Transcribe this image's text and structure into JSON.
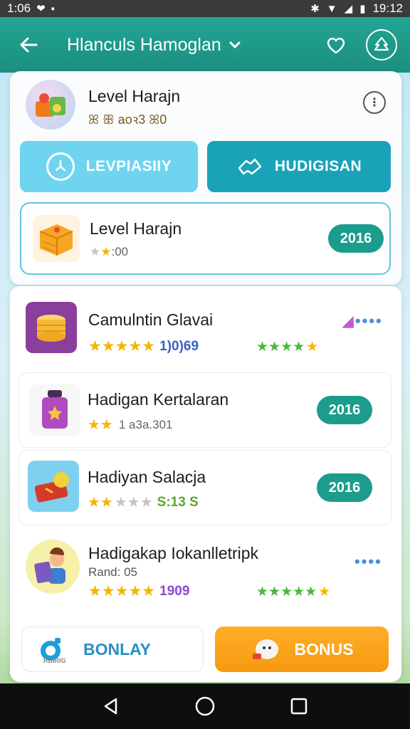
{
  "status_bar": {
    "time": "1:06",
    "right_time": "19:12"
  },
  "app_bar": {
    "title": "Hlanculs Hamoglan"
  },
  "header": {
    "title": "Level Harajn",
    "subtitle": "ꕤ ꕥ aoꝛ3 ꕤ0"
  },
  "tabs": [
    {
      "label": "LEVPIASIIY",
      "icon": "clock-icon"
    },
    {
      "label": "HUDIGISAN",
      "icon": "handshake-icon"
    }
  ],
  "featured": {
    "title": "Level Harajn",
    "rating_text": ":00",
    "badge": "2016"
  },
  "list": [
    {
      "title": "Camulntin Glavai",
      "score": "1)0)69",
      "badge": ""
    },
    {
      "title": "Hadigan Kertalaran",
      "sub": "1 a3a.301",
      "badge": "2016"
    },
    {
      "title": "Hadiyan Salacja",
      "score": "S:13 S",
      "badge": "2016"
    },
    {
      "title": "Hadigakap Iokanlletripk",
      "sub": "Rand: 05",
      "score": "1909"
    }
  ],
  "bottom": {
    "left_label": "BONLAY",
    "left_sub": "RBIRIG",
    "right_label": "BONUS"
  },
  "colors": {
    "appbar": "#1c9a89",
    "tab_left": "#6fd4f0",
    "tab_right": "#1aa3b8",
    "badge": "#1b9c8c",
    "bonus": "#f59a10"
  }
}
